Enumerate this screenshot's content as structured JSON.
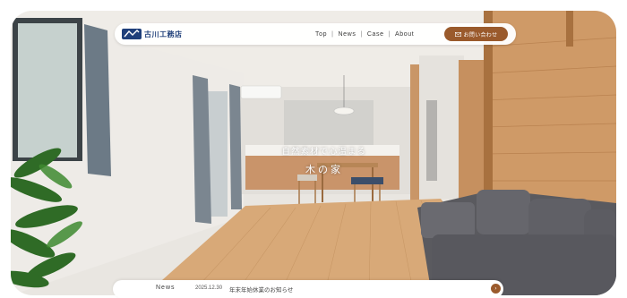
{
  "header": {
    "logo_text": "古川工務店",
    "nav": [
      {
        "label": "Top"
      },
      {
        "label": "News"
      },
      {
        "label": "Case"
      },
      {
        "label": "About"
      }
    ],
    "separator": "|",
    "contact_label": "お問い合わせ"
  },
  "hero": {
    "line1": "自然素材で心温まる",
    "line2": "木の家"
  },
  "news": {
    "label": "News",
    "date": "2025.12.30",
    "title": "年末年始休業のお知らせ",
    "arrow": "›"
  },
  "colors": {
    "accent": "#9a5a2c",
    "brand": "#1f3f7a"
  },
  "icons": {
    "logo": "company-logo-icon",
    "mail": "mail-icon",
    "arrow": "arrow-right-icon"
  }
}
